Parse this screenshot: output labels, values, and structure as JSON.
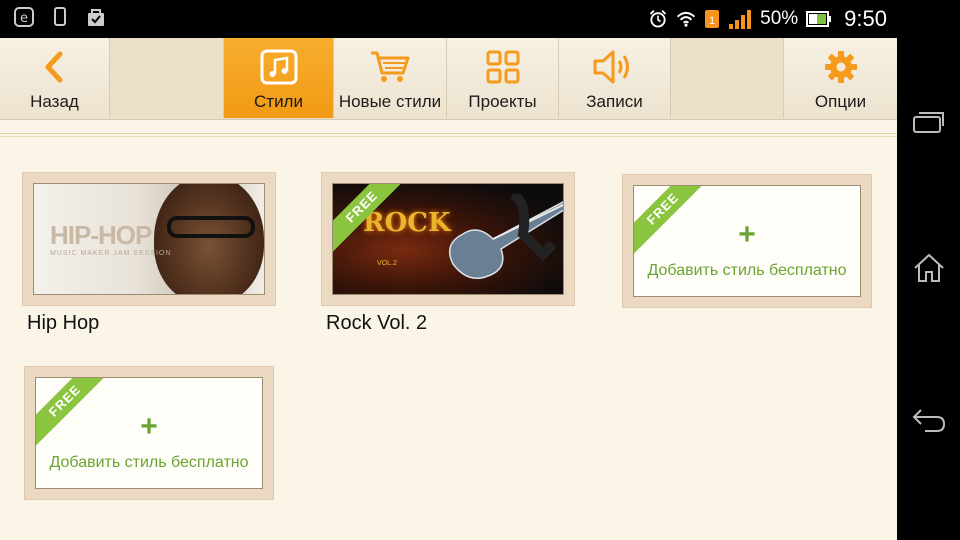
{
  "status_bar": {
    "battery_percent": "50%",
    "time": "9:50",
    "sim_badge": "1",
    "icons": [
      "e-browser-icon",
      "phone-icon",
      "bag-icon",
      "alarm-icon",
      "wifi-icon",
      "sim-icon",
      "signal-icon",
      "battery-icon"
    ]
  },
  "toolbar": {
    "items": [
      {
        "label": "Назад",
        "icon": "back-arrow-icon",
        "active": false
      },
      {
        "label": "Стили",
        "icon": "music-note-icon",
        "active": true
      },
      {
        "label": "Новые стили",
        "icon": "cart-icon",
        "active": false
      },
      {
        "label": "Проекты",
        "icon": "grid-icon",
        "active": false
      },
      {
        "label": "Записи",
        "icon": "speaker-icon",
        "active": false
      },
      {
        "label": "Опции",
        "icon": "gear-icon",
        "active": false
      }
    ]
  },
  "styles": [
    {
      "title": "Hip Hop",
      "art_logo": "HIP-HOP",
      "art_sub": "MUSIC MAKER JAM SESSION"
    },
    {
      "title": "Rock Vol. 2",
      "ribbon": "FREE",
      "art_logo": "ROCK",
      "art_sub": "VOL.2"
    }
  ],
  "add_cards": [
    {
      "ribbon": "FREE",
      "plus": "+",
      "text": "Добавить стиль бесплатно"
    },
    {
      "ribbon": "FREE",
      "plus": "+",
      "text": "Добавить стиль бесплатно"
    }
  ],
  "colors": {
    "accent": "#f29a14",
    "free_green": "#8bc43f",
    "add_text": "#6aa532",
    "background": "#fbf5e7"
  },
  "nav_bar": {
    "icons": [
      "recent-apps-icon",
      "home-icon",
      "back-icon"
    ]
  }
}
